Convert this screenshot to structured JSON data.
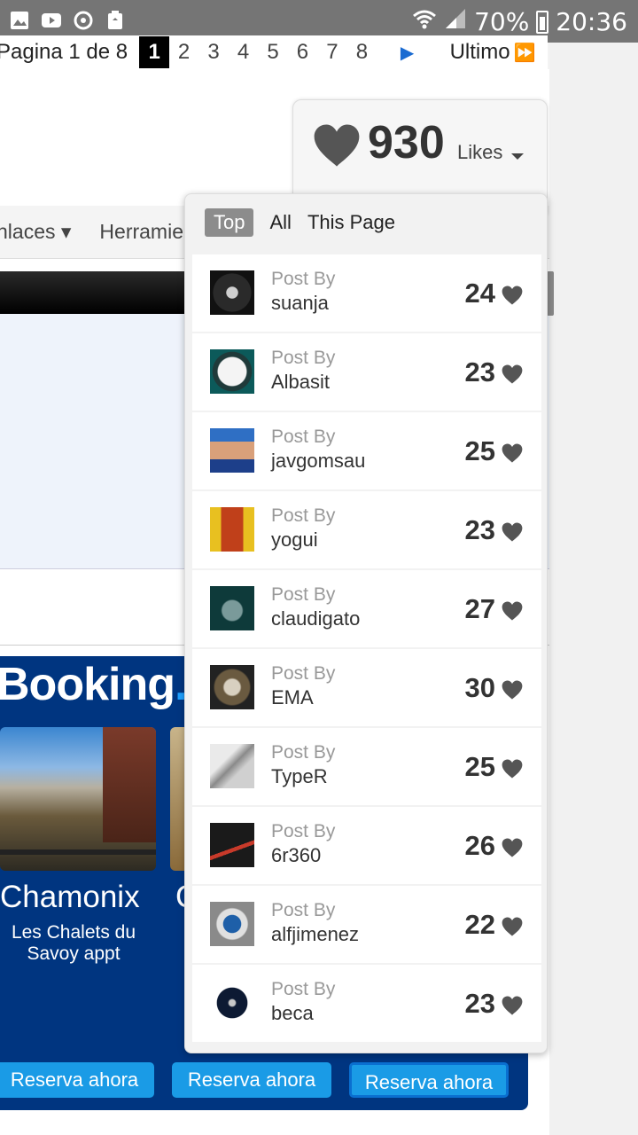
{
  "status_bar": {
    "battery": "70%",
    "time": "20:36",
    "icons": [
      "gallery-icon",
      "youtube-icon",
      "sync-icon",
      "recycle-icon",
      "wifi-icon",
      "signal-icon",
      "battery-icon"
    ]
  },
  "pager": {
    "label": "Pagina 1 de 8",
    "pages": [
      "1",
      "2",
      "3",
      "4",
      "5",
      "6",
      "7",
      "8"
    ],
    "current": "1",
    "last_label": "Ultimo"
  },
  "nav": {
    "item_a": "nlaces",
    "item_b": "Herramie"
  },
  "ad": {
    "logo_main": "Booking",
    "logo_suffix": ".c",
    "hotel_city": "Chamonix",
    "hotel_name": "Les Chalets du Savoy appt",
    "hotel_city_2": "C",
    "reserve_label": "Reserva ahora"
  },
  "likes": {
    "count": "930",
    "label": "Likes",
    "accent": "#555555"
  },
  "dropdown": {
    "tabs": [
      {
        "label": "Top",
        "active": true
      },
      {
        "label": "All",
        "active": false
      },
      {
        "label": "This Page",
        "active": false
      }
    ],
    "post_by_label": "Post By",
    "entries": [
      {
        "author": "suanja",
        "likes": "24"
      },
      {
        "author": "Albasit",
        "likes": "23"
      },
      {
        "author": "javgomsau",
        "likes": "25"
      },
      {
        "author": "yogui",
        "likes": "23"
      },
      {
        "author": "claudigato",
        "likes": "27"
      },
      {
        "author": "EMA",
        "likes": "30"
      },
      {
        "author": "TypeR",
        "likes": "25"
      },
      {
        "author": "6r360",
        "likes": "26"
      },
      {
        "author": "alfjimenez",
        "likes": "22"
      },
      {
        "author": "beca",
        "likes": "23"
      }
    ]
  }
}
